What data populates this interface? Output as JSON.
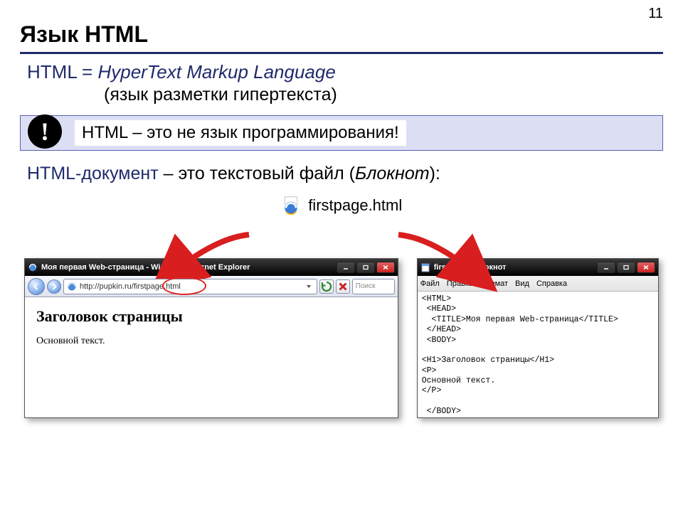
{
  "page_number": "11",
  "title": "Язык HTML",
  "def": {
    "lhs": "HTML = ",
    "rhs": "HyperText Markup Language",
    "sub": "(язык разметки гипертекста)"
  },
  "note": {
    "bang": "!",
    "text": "HTML – это не язык программирования!"
  },
  "doc_line": {
    "a": "HTML-документ",
    "b": " – это текстовый файл (",
    "c": "Блокнот",
    "d": "):"
  },
  "file_label": "firstpage.html",
  "ie": {
    "title": "Моя первая Web-страница - Windows Internet Explorer",
    "url": "http://pupkin.ru/firstpage.html",
    "search_placeholder": "Поиск",
    "h1": "Заголовок страницы",
    "p": "Основной текст."
  },
  "np": {
    "title": "firstpage - Блокнот",
    "menu": [
      "Файл",
      "Правка",
      "Формат",
      "Вид",
      "Справка"
    ],
    "code": "<HTML>\n <HEAD>\n  <TITLE>Моя первая Web-страница</TITLE>\n </HEAD>\n <BODY>\n\n<H1>Заголовок страницы</H1>\n<P>\nОсновной текст.\n</P>\n\n </BODY>\n</HTML>"
  }
}
